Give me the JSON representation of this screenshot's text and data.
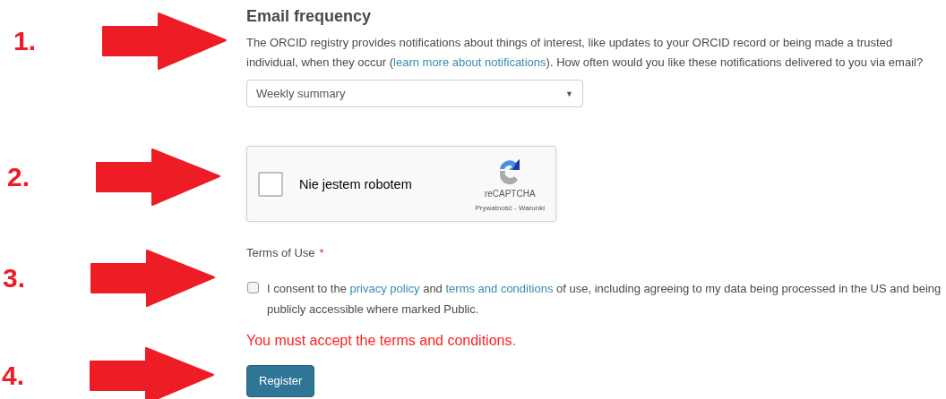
{
  "annotations": [
    {
      "label": "1."
    },
    {
      "label": "2."
    },
    {
      "label": "3."
    },
    {
      "label": "4."
    }
  ],
  "email_frequency": {
    "title": "Email frequency",
    "description_before": "The ORCID registry provides notifications about things of interest, like updates to your ORCID record or being made a trusted individual, when they occur (",
    "link": "learn more about notifications",
    "description_after": "). How often would you like these notifications delivered to you via email?",
    "select": {
      "value": "Weekly summary",
      "caret": "▼"
    }
  },
  "captcha": {
    "checked": false,
    "label": "Nie jestem robotem",
    "brand": "reCAPTCHA",
    "privacy": "Prywatność",
    "separator": " - ",
    "terms": "Warunki"
  },
  "terms": {
    "label": "Terms of Use",
    "required": "*",
    "checked": false,
    "text_before": "I consent to the ",
    "link_1": "privacy policy",
    "text_middle": " and ",
    "link_2": "terms and conditions",
    "text_after": " of use, including agreeing to my data being processed in the US and being publicly accessible where marked Public."
  },
  "error": "You must accept the terms and conditions.",
  "register_button": "Register"
}
